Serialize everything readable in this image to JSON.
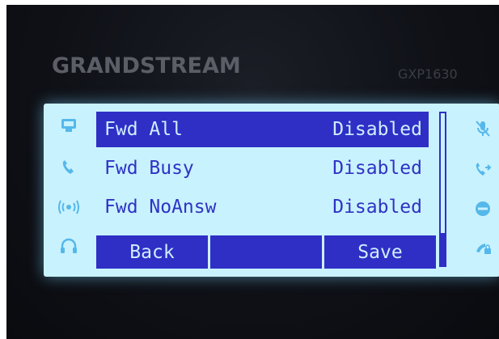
{
  "phone": {
    "brand": "GRANDSTREAM",
    "model": "GXP1630"
  },
  "menu": {
    "items": [
      {
        "label": "Fwd All",
        "value": "Disabled",
        "selected": true
      },
      {
        "label": "Fwd Busy",
        "value": "Disabled",
        "selected": false
      },
      {
        "label": "Fwd NoAnsw",
        "value": "Disabled",
        "selected": false
      }
    ],
    "scroll_position": 1.0
  },
  "softkeys": {
    "back_label": "Back",
    "middle_label": "",
    "save_label": "Save"
  },
  "left_icons": [
    "phonebook-icon",
    "handset-icon",
    "speaker-icon",
    "headset-icon"
  ],
  "right_icons": [
    "mute-icon",
    "transfer-icon",
    "dnd-icon",
    "lock-handset-icon"
  ],
  "colors": {
    "screen_background": "#c9f2ff",
    "lcd_ink": "#2f33c4",
    "selection_background": "#2f2fc6",
    "icon_color": "#55b8ea"
  }
}
